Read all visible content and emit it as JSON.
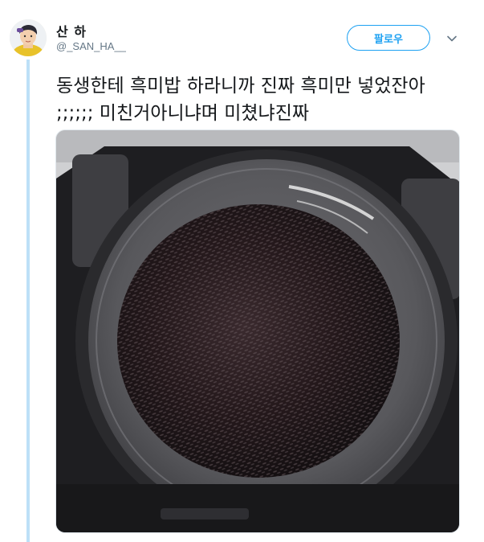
{
  "tweet": {
    "display_name": "산 하",
    "username": "@_SAN_HA__",
    "follow_label": "팔로우",
    "text": "동생한테 흑미밥 하라니까 진짜 흑미만 넣었잔아 ;;;;;; 미친거아니냐며 미쳤냐진짜"
  },
  "icons": {
    "avatar": "profile-avatar",
    "caret": "chevron-down-icon"
  },
  "colors": {
    "accent": "#1da1f2",
    "thread_line": "#bde0f7",
    "text": "#14171a",
    "secondary_text": "#657786"
  }
}
